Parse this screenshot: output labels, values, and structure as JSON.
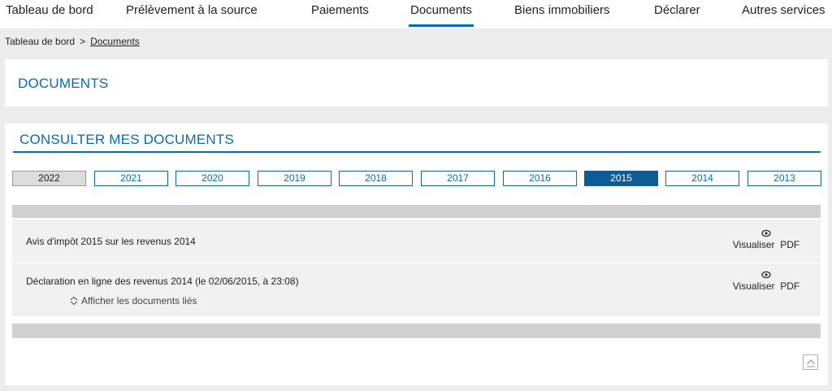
{
  "nav": {
    "items": [
      {
        "label": "Tableau de bord"
      },
      {
        "label": "Prélèvement à la source"
      },
      {
        "label": "Paiements"
      },
      {
        "label": "Documents"
      },
      {
        "label": "Biens immobiliers"
      },
      {
        "label": "Déclarer"
      },
      {
        "label": "Autres services"
      }
    ],
    "active_index": 3
  },
  "breadcrumb": {
    "home": "Tableau de bord",
    "separator": ">",
    "current": "Documents"
  },
  "page": {
    "title": "DOCUMENTS"
  },
  "consult": {
    "title": "CONSULTER MES DOCUMENTS",
    "years": [
      "2022",
      "2021",
      "2020",
      "2019",
      "2018",
      "2017",
      "2016",
      "2015",
      "2014",
      "2013"
    ],
    "selected_year": "2015",
    "current_year": "2022",
    "documents": [
      {
        "label": "Avis d'impôt 2015 sur les revenus 2014",
        "action": "Visualiser  PDF"
      },
      {
        "label": "Déclaration en ligne des revenus 2014 (le 02/06/2015, à 23:08)",
        "action": "Visualiser  PDF",
        "related": "Afficher les documents liés"
      }
    ]
  },
  "icons": {
    "view": "eye-icon",
    "related": "expand-chevrons-icon",
    "scroll_top": "chevron-up-icon"
  },
  "colors": {
    "accent": "#0d6aa8",
    "selected_tab": "#0d5c96",
    "background": "#ececec"
  }
}
